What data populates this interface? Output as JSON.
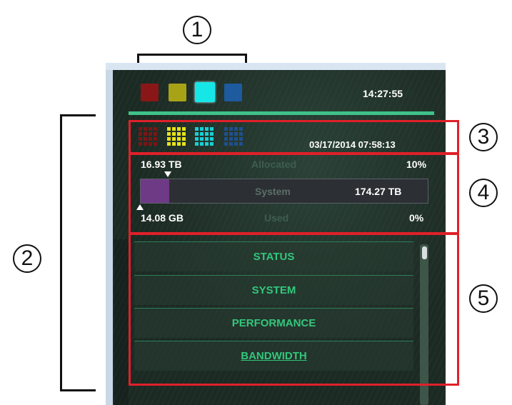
{
  "callouts": {
    "c1": "1",
    "c2": "2",
    "c3": "3",
    "c4": "4",
    "c5": "5"
  },
  "header": {
    "time": "14:27:55"
  },
  "status_row": {
    "datetime": "03/17/2014 07:58:13"
  },
  "storage": {
    "allocated": {
      "value": "16.93 TB",
      "label": "Allocated",
      "percent": "10%"
    },
    "system": {
      "label": "System",
      "value": "174.27 TB"
    },
    "used": {
      "value": "14.08 GB",
      "label": "Used",
      "percent": "0%"
    },
    "bar_fill_fraction": 0.1
  },
  "menu": {
    "items": [
      {
        "label": "STATUS"
      },
      {
        "label": "SYSTEM"
      },
      {
        "label": "PERFORMANCE"
      },
      {
        "label": "BANDWIDTH"
      }
    ]
  },
  "colors": {
    "accent_green": "#3fc28a",
    "highlight_red": "#e0202a",
    "bar_purple": "#6e3a86"
  },
  "icons": [
    "red-swatch-icon",
    "yellow-swatch-icon",
    "cyan-swatch-icon",
    "blue-swatch-icon",
    "red-grid-icon",
    "yellow-grid-icon",
    "cyan-grid-icon",
    "blue-grid-icon"
  ]
}
